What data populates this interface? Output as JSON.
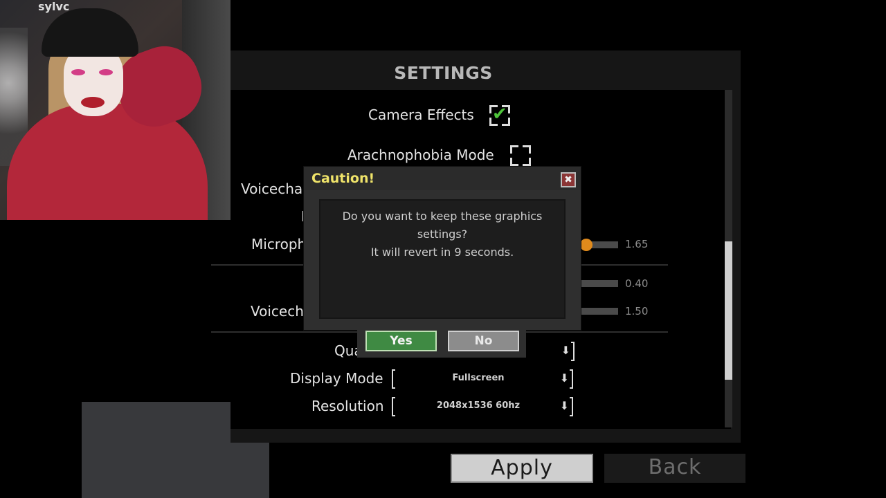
{
  "webcam": {
    "tag": "sylvc"
  },
  "settings": {
    "title": "SETTINGS",
    "camera_effects": {
      "label": "Camera Effects",
      "checked": true
    },
    "arachnophobia": {
      "label": "Arachnophobia Mode",
      "checked": false
    },
    "row_voicechat_partial": "Voicecha",
    "row_m_partial": "M",
    "row_microphone_partial": "Microph",
    "row_voicechat2_partial": "Voicecha",
    "row_quality_partial": "Qua",
    "slider_mic": {
      "value": "1.65"
    },
    "slider_b": {
      "value": "0.40"
    },
    "slider_c": {
      "value": "1.50"
    },
    "display_mode": {
      "label": "Display Mode",
      "value": "Fullscreen"
    },
    "resolution": {
      "label": "Resolution",
      "value": "2048x1536 60hz"
    },
    "apply_label": "Apply",
    "back_label": "Back"
  },
  "dialog": {
    "title": "Caution!",
    "close_icon": "close-icon",
    "message_line1": "Do you want to keep these graphics",
    "message_line2": "settings?",
    "message_line3": "It will revert in 9 seconds.",
    "yes_label": "Yes",
    "no_label": "No"
  },
  "colors": {
    "accent_yes": "#3f8a43",
    "title_yellow": "#f0e46a",
    "slider_knob": "#e08a1c",
    "check_green": "#4ec33a"
  }
}
